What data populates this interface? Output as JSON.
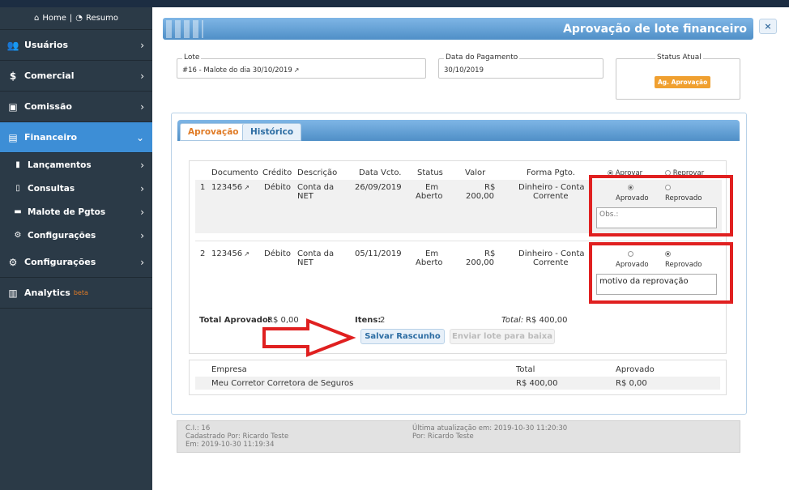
{
  "sidebar": {
    "home_label": "Home",
    "resumo_label": "Resumo",
    "items": [
      {
        "label": "Usuários",
        "icon": "users-icon"
      },
      {
        "label": "Comercial",
        "icon": "dollar-icon"
      },
      {
        "label": "Comissão",
        "icon": "money-icon"
      },
      {
        "label": "Financeiro",
        "icon": "briefcase-icon"
      },
      {
        "label": "Configurações",
        "icon": "gears-icon"
      },
      {
        "label": "Analytics",
        "icon": "bar-chart-icon",
        "badge": "beta"
      }
    ],
    "submenu": [
      {
        "label": "Lançamentos"
      },
      {
        "label": "Consultas"
      },
      {
        "label": "Malote de Pgtos"
      },
      {
        "label": "Configurações"
      }
    ]
  },
  "dialog": {
    "title": "Aprovação de lote financeiro",
    "close_label": "×"
  },
  "fields": {
    "lote_label": "Lote",
    "lote_value": "#16 - Malote do dia 30/10/2019",
    "data_label": "Data do Pagamento",
    "data_value": "30/10/2019",
    "status_label": "Status Atual",
    "status_value": "Ag. Aprovação"
  },
  "tabs": [
    {
      "label": "Aprovação",
      "active": true
    },
    {
      "label": "Histórico",
      "active": false
    }
  ],
  "table": {
    "headers": [
      "Documento",
      "Crédito",
      "Descrição",
      "Data Vcto.",
      "Status",
      "Valor",
      "Forma Pgto."
    ],
    "top_radio_labels": [
      "Aprovar",
      "Reprovar"
    ],
    "rows": [
      {
        "num": "1",
        "documento": "123456",
        "credito": "Débito",
        "descricao_l1": "Conta da",
        "descricao_l2": "NET",
        "data": "26/09/2019",
        "status_l1": "Em",
        "status_l2": "Aberto",
        "valor_l1": "R$",
        "valor_l2": "200,00",
        "forma_l1": "Dinheiro - Conta",
        "forma_l2": "Corrente",
        "aprovado_label": "Aprovado",
        "reprovado_label": "Reprovado",
        "selected": "aprovado",
        "obs_placeholder": "Obs.:",
        "obs_value": ""
      },
      {
        "num": "2",
        "documento": "123456",
        "credito": "Débito",
        "descricao_l1": "Conta da",
        "descricao_l2": "NET",
        "data": "05/11/2019",
        "status_l1": "Em",
        "status_l2": "Aberto",
        "valor_l1": "R$",
        "valor_l2": "200,00",
        "forma_l1": "Dinheiro - Conta",
        "forma_l2": "Corrente",
        "aprovado_label": "Aprovado",
        "reprovado_label": "Reprovado",
        "selected": "reprovado",
        "obs_placeholder": "Obs.:",
        "obs_value": "motivo da reprovação"
      }
    ]
  },
  "totals": {
    "aprovado_label": "Total Aprovado:",
    "aprovado_value": "R$ 0,00",
    "itens_label": "Itens:",
    "itens_value": "2",
    "total_label": "Total:",
    "total_value": "R$ 400,00"
  },
  "buttons": {
    "salvar": "Salvar Rascunho",
    "enviar": "Enviar lote para baixa"
  },
  "empresa": {
    "headers": [
      "Empresa",
      "Total",
      "Aprovado"
    ],
    "row": {
      "empresa": "Meu Corretor Corretora de Seguros",
      "total": "R$ 400,00",
      "aprovado": "R$ 0,00"
    }
  },
  "footer": {
    "ci": "C.I.: 16",
    "cadastrado": "Cadastrado Por: Ricardo Teste",
    "em": "Em: 2019-10-30 11:19:34",
    "ultima": "Última atualização em: 2019-10-30 11:20:30",
    "por": "Por: Ricardo Teste"
  },
  "colors": {
    "annotation_red": "#e02020",
    "status_orange": "#f0a030",
    "sidebar_bg": "#2b3a47",
    "sidebar_active": "#3d8ed6"
  }
}
